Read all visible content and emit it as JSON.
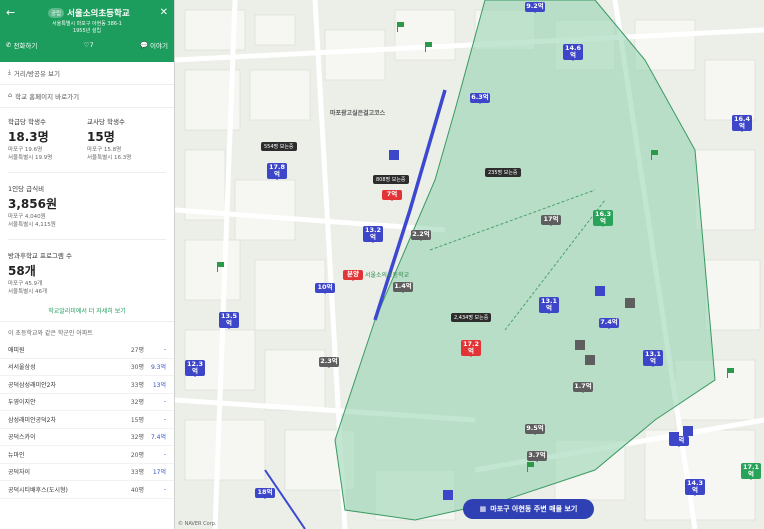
{
  "school": {
    "type_badge": "공립",
    "name": "서울소의초등학교",
    "address": "서울특별시 마포구 아현동 386-1",
    "founded": "1955년 설립",
    "actions": {
      "share": "전화하기",
      "like": "♡7",
      "story": "이야기"
    }
  },
  "links": {
    "route": "거리/방공유 보기",
    "homepage": "학교 홈페이지 바로가기"
  },
  "stats": {
    "per_class": {
      "label": "학급당 학생수",
      "value": "18.3명",
      "gu": "마포구 19.6명",
      "city": "서울특별시 19.9명"
    },
    "per_teacher": {
      "label": "교사당 학생수",
      "value": "15명",
      "gu": "마포구 15.8명",
      "city": "서울특별시 16.3명"
    },
    "meal": {
      "label": "1인당 급식비",
      "value": "3,856원",
      "gu": "마포구 4,040원",
      "city": "서울특별시 4,115원"
    },
    "program": {
      "label": "방과후학교 프로그램 수",
      "value": "58개",
      "gu": "마포구 45.9개",
      "city": "서울특별시 46개"
    }
  },
  "more_link": "학교알리미에서 더 자세히 보기",
  "apt_header": "이 초등학교와 같은 학군인 아파트",
  "apartments": [
    {
      "name": "애피원",
      "floor": "27평",
      "price": "-"
    },
    {
      "name": "서서울삼성",
      "floor": "30평",
      "price": "9.3억"
    },
    {
      "name": "공덕삼성래미안2차",
      "floor": "33평",
      "price": "13억"
    },
    {
      "name": "두영이지안",
      "floor": "32평",
      "price": "-"
    },
    {
      "name": "삼성래미안공덕2차",
      "floor": "15평",
      "price": "-"
    },
    {
      "name": "공덕스카이",
      "floor": "32평",
      "price": "7.4억"
    },
    {
      "name": "뉴마인",
      "floor": "20평",
      "price": "-"
    },
    {
      "name": "공덕자이",
      "floor": "33평",
      "price": "17억"
    },
    {
      "name": "공덕시티배후스(도시형)",
      "floor": "40평",
      "price": "-"
    }
  ],
  "map": {
    "labels": {
      "golf": "마포광고실은걸고코스",
      "school_label": "서울소의초등학교",
      "cta": "마포구 아현동 주변 매물 보기",
      "copyright": "© NAVER Corp."
    },
    "tips": [
      "554명 보는중",
      "808명 보는중",
      "235명 보는중",
      "2,434명 보는중"
    ],
    "markers": [
      {
        "color": "blue",
        "label": "17.8억"
      },
      {
        "color": "blue",
        "label": "13.2억"
      },
      {
        "color": "gray",
        "label": "2.2억"
      },
      {
        "color": "red",
        "label": "7억"
      },
      {
        "color": "blue",
        "label": "6.3억"
      },
      {
        "color": "blue",
        "label": "14.6억"
      },
      {
        "color": "blue",
        "label": "16.4억"
      },
      {
        "color": "gray",
        "label": "17억"
      },
      {
        "color": "blue",
        "label": "10억"
      },
      {
        "color": "red",
        "label": "분양"
      },
      {
        "color": "gray",
        "label": "1.4억"
      },
      {
        "color": "blue",
        "label": "13.1억"
      },
      {
        "color": "blue",
        "label": "7.4억"
      },
      {
        "color": "red",
        "label": "17.2억"
      },
      {
        "color": "blue",
        "label": "13.5억"
      },
      {
        "color": "gray",
        "label": "2.3억"
      },
      {
        "color": "blue",
        "label": "12.3억"
      },
      {
        "color": "gray",
        "label": "1.7억"
      },
      {
        "color": "gray",
        "label": "9.5억"
      },
      {
        "color": "gray",
        "label": "3.7억"
      },
      {
        "color": "blue",
        "label": "13.1억"
      },
      {
        "color": "blue",
        "label": "9억"
      },
      {
        "color": "blue",
        "label": "14.3억"
      },
      {
        "color": "blue",
        "label": "18억"
      },
      {
        "color": "blue",
        "label": "9.2억"
      },
      {
        "color": "green",
        "label": "16.3억"
      },
      {
        "color": "green",
        "label": "17.1억"
      }
    ]
  },
  "colors": {
    "brand": "#1d9d5d",
    "zone": "#8fd1ad",
    "price_text": "#3150c9"
  }
}
